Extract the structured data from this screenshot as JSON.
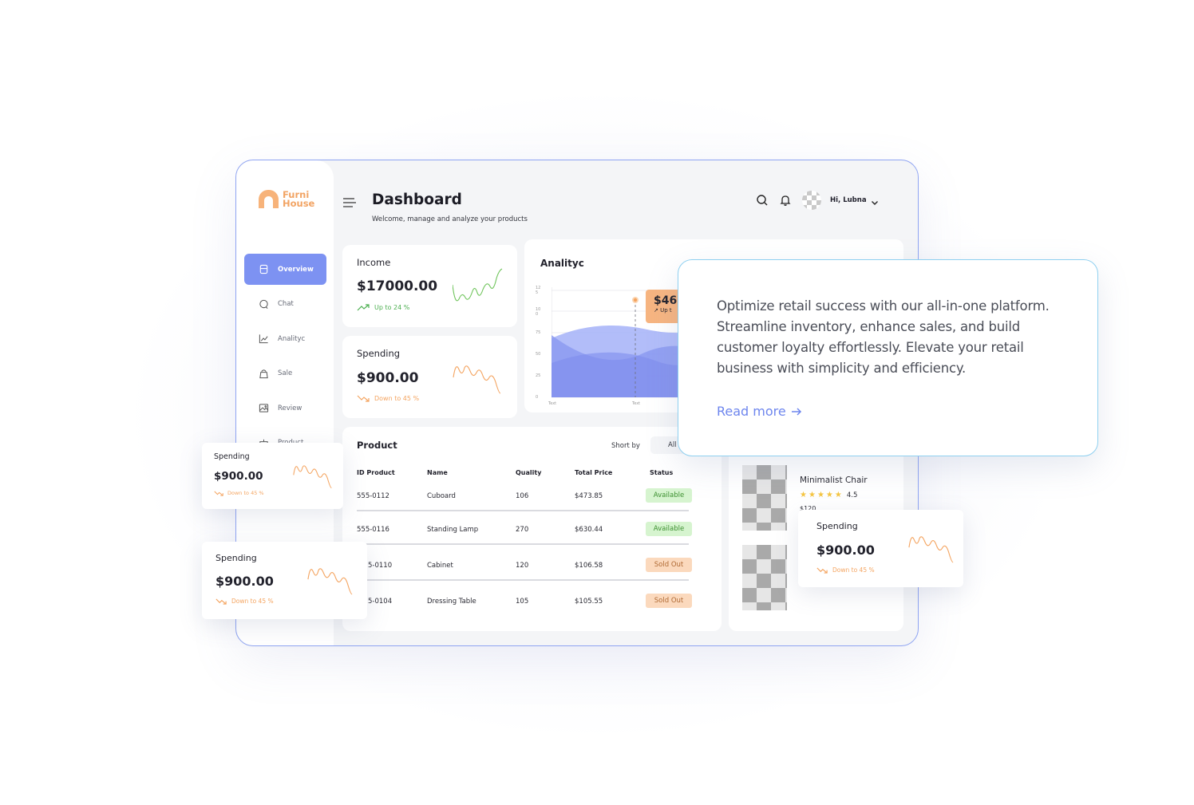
{
  "brand": {
    "line1": "Furni",
    "line2": "House",
    "color": "#f2a464"
  },
  "accent": "#7d92f2",
  "sidebar": {
    "items": [
      {
        "label": "Overview",
        "icon": "store-icon",
        "active": true
      },
      {
        "label": "Chat",
        "icon": "chat-icon"
      },
      {
        "label": "Analityc",
        "icon": "analytics-icon"
      },
      {
        "label": "Sale",
        "icon": "bag-icon"
      },
      {
        "label": "Review",
        "icon": "image-icon"
      },
      {
        "label": "Product",
        "icon": "product-icon"
      }
    ]
  },
  "header": {
    "title": "Dashboard",
    "subtitle": "Welcome, manage and analyze your products",
    "greeting": "Hi, Lubna"
  },
  "income": {
    "label": "Income",
    "value": "$17000.00",
    "trend": "Up to 24 %"
  },
  "spending": {
    "label": "Spending",
    "value": "$900.00",
    "trend": "Down to 45 %"
  },
  "analytics": {
    "title": "Analityc",
    "tooltip_value": "$46",
    "tooltip_sub": "Up t",
    "y_ticks": [
      "12\n5",
      "10\n0",
      "75",
      "50",
      "25",
      "0"
    ],
    "x_ticks": [
      "Text",
      "Text"
    ]
  },
  "products": {
    "title": "Product",
    "sort_label": "Short by",
    "sort_value": "All",
    "columns": [
      "ID Product",
      "Name",
      "Quality",
      "Total Price",
      "Status"
    ],
    "rows": [
      {
        "id": "555-0112",
        "name": "Cuboard",
        "quality": "106",
        "price": "$473.85",
        "status": "Available"
      },
      {
        "id": "555-0116",
        "name": "Standing Lamp",
        "quality": "270",
        "price": "$630.44",
        "status": "Available"
      },
      {
        "id": "5-0110",
        "name": "Cabinet",
        "quality": "120",
        "price": "$106.58",
        "status": "Sold Out"
      },
      {
        "id": "5-0104",
        "name": "Dressing Table",
        "quality": "105",
        "price": "$105.55",
        "status": "Sold Out"
      }
    ]
  },
  "featured": {
    "name": "Minimalist Chair",
    "rating": "4.5",
    "price": "$120"
  },
  "promo": {
    "text": "Optimize retail success with our all-in-one platform. Streamline inventory, enhance sales, and build customer loyalty effortlessly. Elevate your retail business with simplicity and efficiency.",
    "link": "Read more"
  }
}
